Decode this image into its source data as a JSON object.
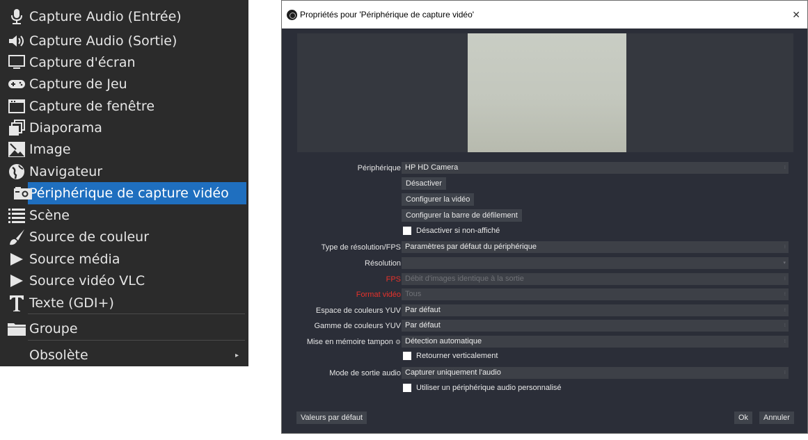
{
  "menu": {
    "items": [
      {
        "label": "Capture Audio (Entrée)",
        "icon": "microphone-icon"
      },
      {
        "label": "Capture Audio (Sortie)",
        "icon": "speaker-icon"
      },
      {
        "label": "Capture d'écran",
        "icon": "monitor-icon"
      },
      {
        "label": "Capture de Jeu",
        "icon": "gamepad-icon"
      },
      {
        "label": "Capture de fenêtre",
        "icon": "window-icon"
      },
      {
        "label": "Diaporama",
        "icon": "slideshow-icon"
      },
      {
        "label": "Image",
        "icon": "image-icon"
      },
      {
        "label": "Navigateur",
        "icon": "globe-icon"
      },
      {
        "label": "Périphérique de capture vidéo",
        "icon": "camera-icon"
      },
      {
        "label": "Scène",
        "icon": "list-icon"
      },
      {
        "label": "Source de couleur",
        "icon": "brush-icon"
      },
      {
        "label": "Source média",
        "icon": "play-icon"
      },
      {
        "label": "Source vidéo VLC",
        "icon": "play-icon"
      },
      {
        "label": "Texte (GDI+)",
        "icon": "text-icon"
      },
      {
        "label": "Groupe",
        "icon": "folder-icon"
      },
      {
        "label": "Obsolète",
        "icon": ""
      }
    ],
    "submenu_arrow": "▸"
  },
  "dialog": {
    "title": "Propriétés pour 'Périphérique de capture vidéo'",
    "close": "✕",
    "device_label": "Périphérique",
    "device_value": "HP HD Camera",
    "btn_deactivate": "Désactiver",
    "btn_config_video": "Configurer la vidéo",
    "btn_config_crossbar": "Configurer la barre de défilement",
    "chk_deactivate_hidden": "Désactiver si non-affiché",
    "res_type_label": "Type de résolution/FPS",
    "res_type_value": "Paramètres par défaut du périphérique",
    "resolution_label": "Résolution",
    "resolution_value": "",
    "fps_label": "FPS",
    "fps_value": "Débit d'images identique à la sortie",
    "format_label": "Format vidéo",
    "format_value": "Tous",
    "yuv_space_label": "Espace de couleurs YUV",
    "yuv_space_value": "Par défaut",
    "yuv_range_label": "Gamme de couleurs YUV",
    "yuv_range_value": "Par défaut",
    "buffering_label": "Mise en mémoire tampon",
    "buffering_value": "Détection automatique",
    "chk_flip": "Retourner verticalement",
    "audio_mode_label": "Mode de sortie audio",
    "audio_mode_value": "Capturer uniquement l'audio",
    "chk_custom_audio": "Utiliser un périphérique audio personnalisé",
    "btn_defaults": "Valeurs par défaut",
    "btn_ok": "Ok",
    "btn_cancel": "Annuler",
    "spin_glyph": "⁝"
  }
}
